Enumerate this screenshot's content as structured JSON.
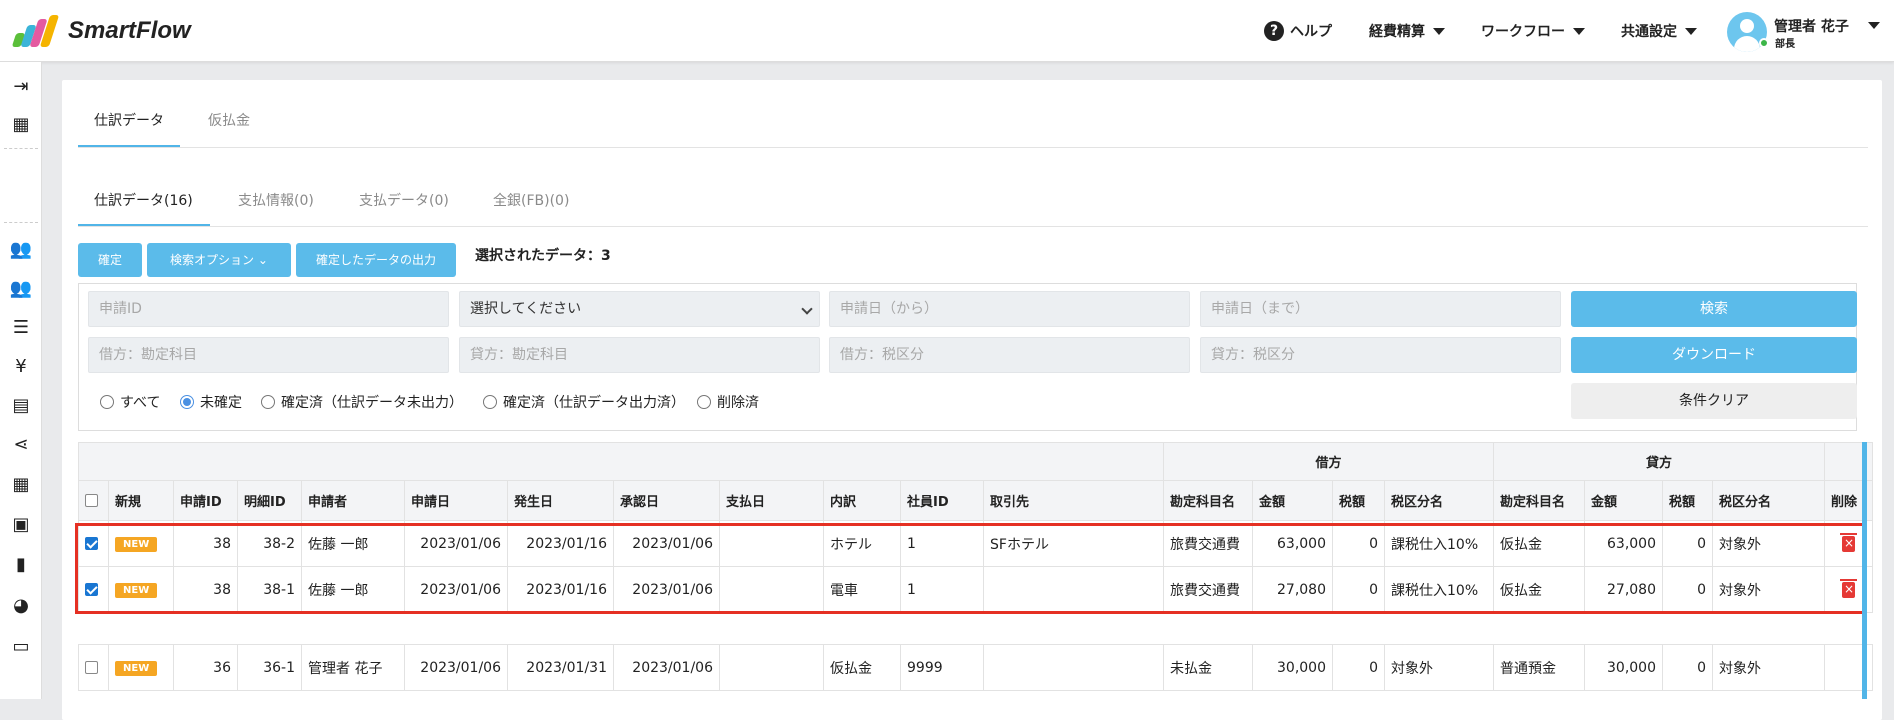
{
  "app": {
    "name": "SmartFlow"
  },
  "header": {
    "help_label": "ヘルプ",
    "menus": [
      {
        "label": "経費精算"
      },
      {
        "label": "ワークフロー"
      },
      {
        "label": "共通設定"
      }
    ],
    "user": {
      "name": "管理者 花子",
      "role": "部長"
    }
  },
  "main_tabs": [
    {
      "label": "仕訳データ",
      "active": true
    },
    {
      "label": "仮払金",
      "active": false
    }
  ],
  "sub_tabs": [
    {
      "label": "仕訳データ(16)",
      "active": true
    },
    {
      "label": "支払情報(0)",
      "active": false
    },
    {
      "label": "支払データ(0)",
      "active": false
    },
    {
      "label": "全銀(FB)(0)",
      "active": false
    }
  ],
  "toolbar": {
    "confirm": "確定",
    "search_options": "検索オプション",
    "export": "確定したデータの出力",
    "selected_info": "選択されたデータ：3"
  },
  "filters": {
    "request_id": "申請ID",
    "select_default": "選択してください",
    "date_from": "申請日（から）",
    "date_to": "申請日（まで）",
    "debit_account": "借方：勘定科目",
    "credit_account": "貸方：勘定科目",
    "debit_tax": "借方：税区分",
    "credit_tax": "貸方：税区分",
    "search": "検索",
    "download": "ダウンロード",
    "clear": "条件クリア",
    "radios": [
      {
        "label": "すべて",
        "checked": false
      },
      {
        "label": "未確定",
        "checked": true
      },
      {
        "label": "確定済（仕訳データ未出力）",
        "checked": false
      },
      {
        "label": "確定済（仕訳データ出力済）",
        "checked": false
      },
      {
        "label": "削除済",
        "checked": false
      }
    ]
  },
  "table": {
    "group_debit": "借方",
    "group_credit": "貸方",
    "headers": {
      "new": "新規",
      "request_id": "申請ID",
      "detail_id": "明細ID",
      "applicant": "申請者",
      "apply_date": "申請日",
      "occur_date": "発生日",
      "approve_date": "承認日",
      "pay_date": "支払日",
      "breakdown": "内訳",
      "employee_id": "社員ID",
      "vendor": "取引先",
      "d_account": "勘定科目名",
      "d_amount": "金額",
      "d_tax": "税額",
      "d_taxcat": "税区分名",
      "c_account": "勘定科目名",
      "c_amount": "金額",
      "c_tax": "税額",
      "c_taxcat": "税区分名",
      "delete": "削除"
    },
    "rows": [
      {
        "checked": true,
        "badge": "NEW",
        "request_id": "38",
        "detail_id": "38-2",
        "applicant": "佐藤 一郎",
        "apply_date": "2023/01/06",
        "occur_date": "2023/01/16",
        "approve_date": "2023/01/06",
        "pay_date": "",
        "breakdown": "ホテル",
        "employee_id": "1",
        "vendor": "SFホテル",
        "d_account": "旅費交通費",
        "d_amount": "63,000",
        "d_tax": "0",
        "d_taxcat": "課税仕入10%",
        "c_account": "仮払金",
        "c_amount": "63,000",
        "c_tax": "0",
        "c_taxcat": "対象外"
      },
      {
        "checked": true,
        "badge": "NEW",
        "request_id": "38",
        "detail_id": "38-1",
        "applicant": "佐藤 一郎",
        "apply_date": "2023/01/06",
        "occur_date": "2023/01/16",
        "approve_date": "2023/01/06",
        "pay_date": "",
        "breakdown": "電車",
        "employee_id": "1",
        "vendor": "",
        "d_account": "旅費交通費",
        "d_amount": "27,080",
        "d_tax": "0",
        "d_taxcat": "課税仕入10%",
        "c_account": "仮払金",
        "c_amount": "27,080",
        "c_tax": "0",
        "c_taxcat": "対象外"
      },
      {
        "checked": false,
        "badge": "NEW",
        "request_id": "36",
        "detail_id": "36-1",
        "applicant": "管理者 花子",
        "apply_date": "2023/01/06",
        "occur_date": "2023/01/31",
        "approve_date": "2023/01/06",
        "pay_date": "",
        "breakdown": "仮払金",
        "employee_id": "9999",
        "vendor": "",
        "d_account": "未払金",
        "d_amount": "30,000",
        "d_tax": "0",
        "d_taxcat": "対象外",
        "c_account": "普通預金",
        "c_amount": "30,000",
        "c_tax": "0",
        "c_taxcat": "対象外"
      }
    ]
  },
  "colors": {
    "accent": "#5bbbea",
    "highlight": "#e53023",
    "badge": "#f5a623",
    "delete": "#e53935"
  }
}
